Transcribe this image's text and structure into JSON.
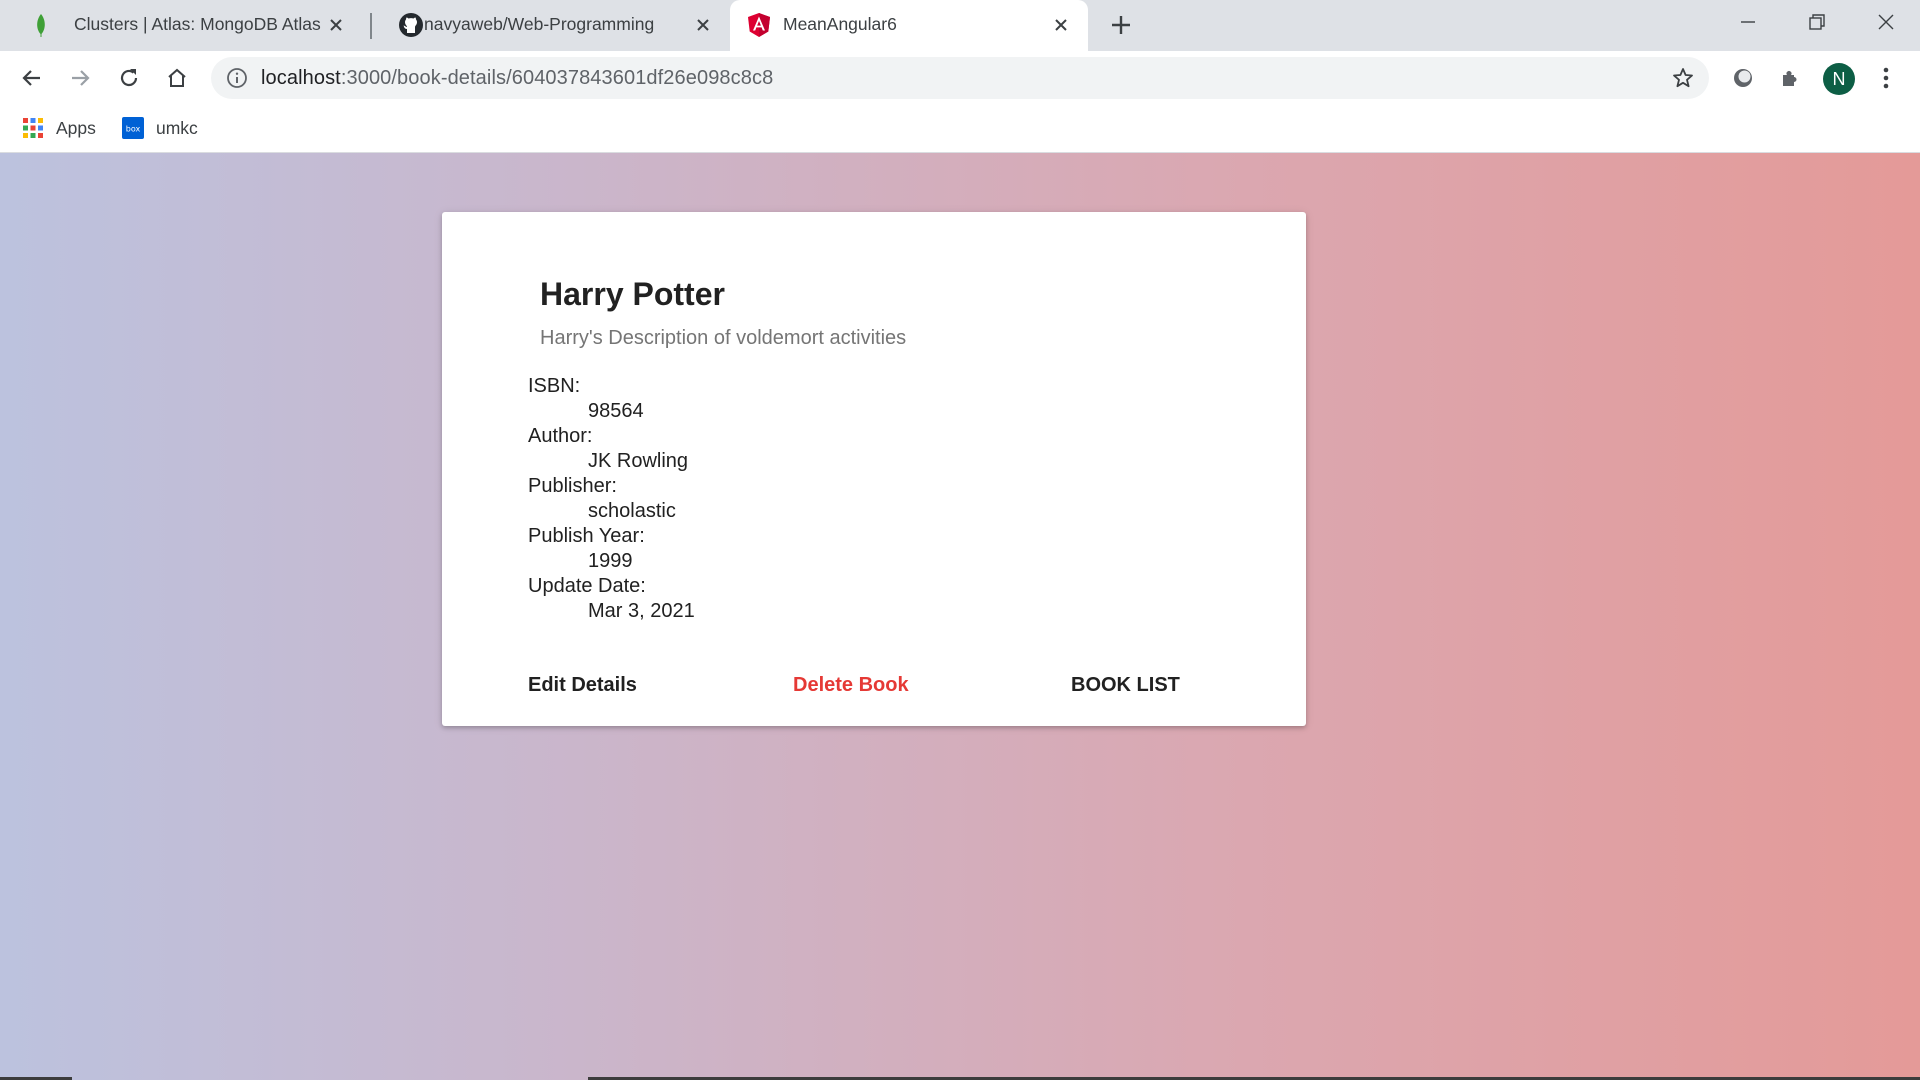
{
  "browser": {
    "tabs": [
      {
        "title": "Clusters | Atlas: MongoDB Atlas",
        "icon": "mongodb-leaf-icon",
        "active": false
      },
      {
        "title": "navyaweb/Web-Programming",
        "icon": "github-icon",
        "active": false
      },
      {
        "title": "MeanAngular6",
        "icon": "angular-icon",
        "active": true
      }
    ],
    "address": {
      "host": "localhost",
      "path": ":3000/book-details/604037843601df26e098c8c8"
    },
    "profile_initial": "N",
    "bookmarks": [
      {
        "label": "Apps",
        "icon": "apps-grid-icon"
      },
      {
        "label": "umkc",
        "icon": "box-icon"
      }
    ]
  },
  "book": {
    "title": "Harry Potter",
    "description": "Harry's Description of voldemort activities",
    "fields": [
      {
        "label": "ISBN:",
        "value": "98564"
      },
      {
        "label": "Author:",
        "value": "JK Rowling"
      },
      {
        "label": "Publisher:",
        "value": "scholastic"
      },
      {
        "label": "Publish Year:",
        "value": "1999"
      },
      {
        "label": "Update Date:",
        "value": "Mar 3, 2021"
      }
    ]
  },
  "actions": {
    "edit": "Edit Details",
    "delete": "Delete Book",
    "list": "BOOK LIST"
  },
  "colors": {
    "delete": "#e53935",
    "text": "#212121"
  }
}
